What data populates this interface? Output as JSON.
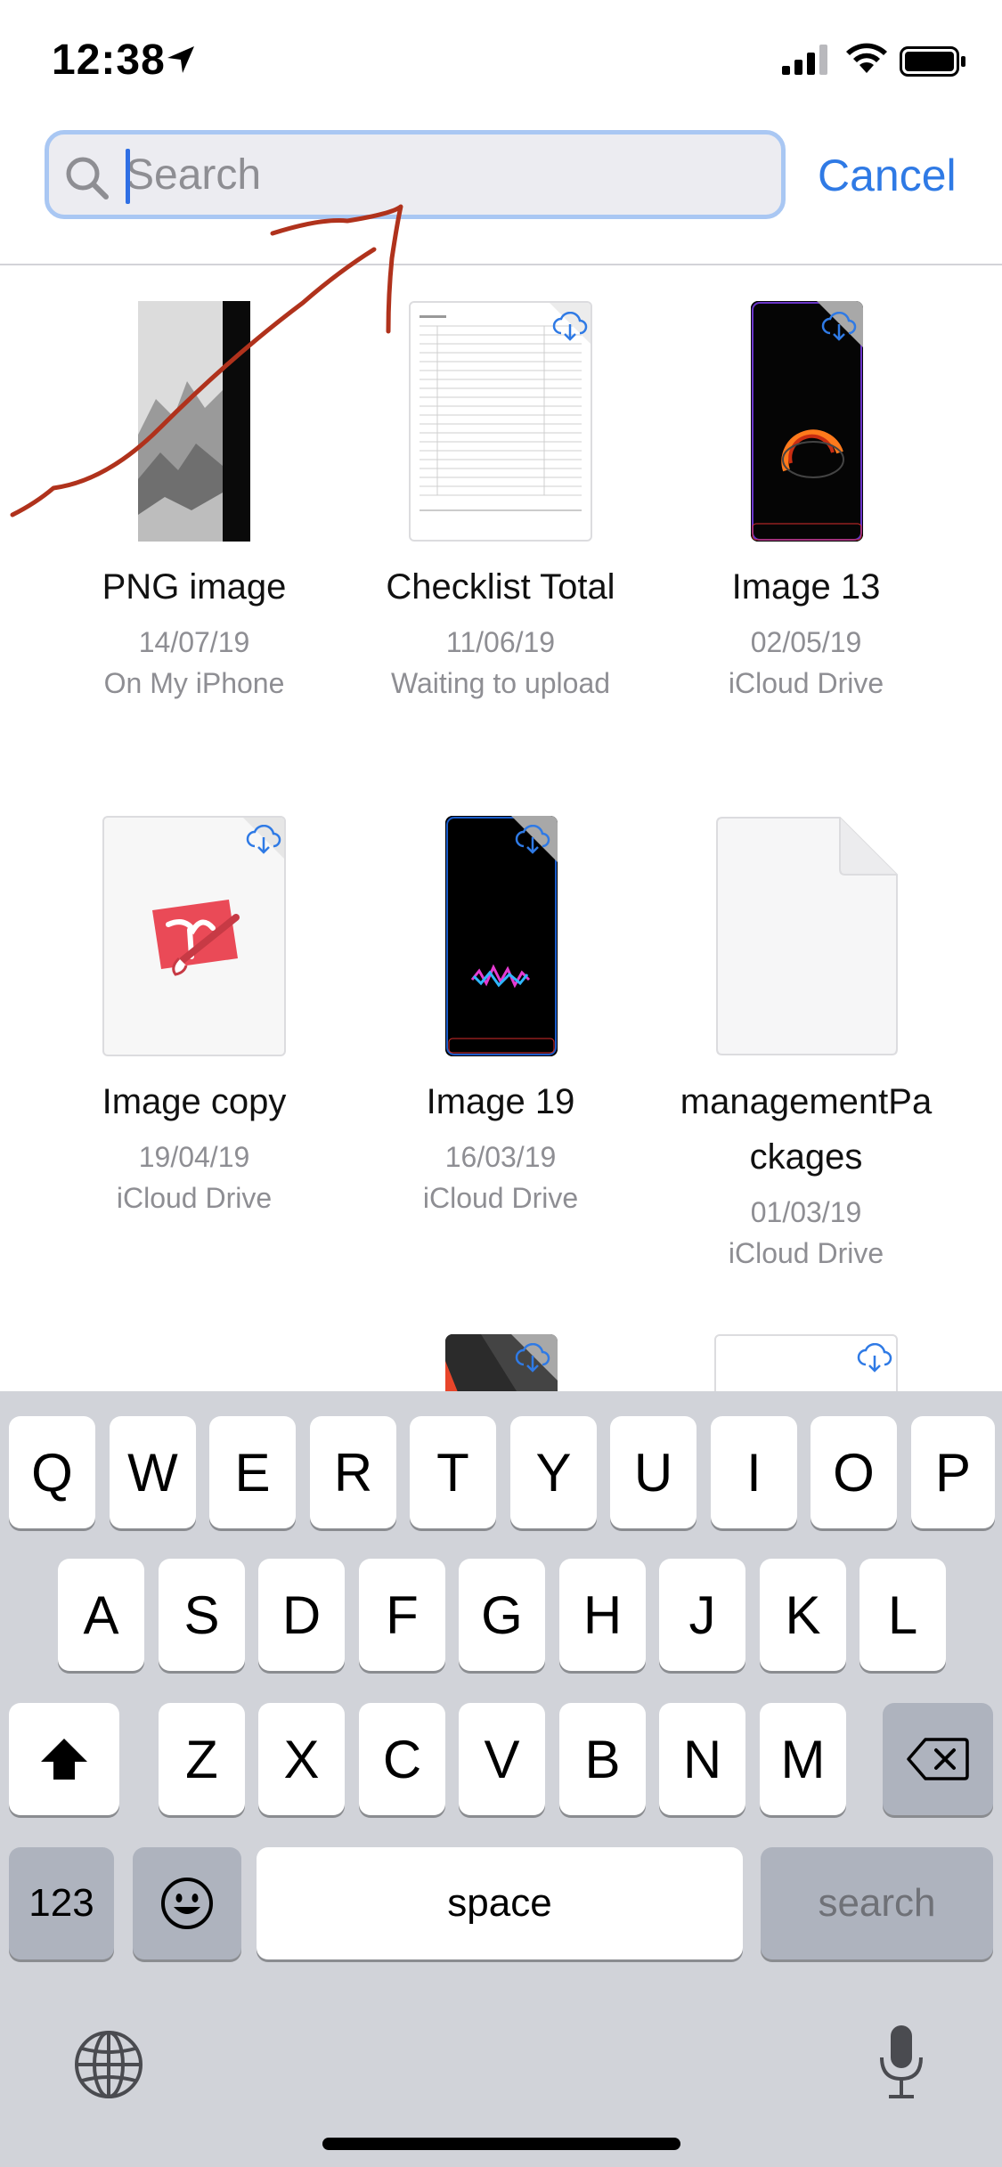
{
  "status_bar": {
    "time": "12:38"
  },
  "search": {
    "placeholder": "Search",
    "value": "",
    "cancel_label": "Cancel"
  },
  "files": [
    {
      "name": "PNG image",
      "date": "14/07/19",
      "location": "On My iPhone"
    },
    {
      "name": "Checklist Total",
      "date": "11/06/19",
      "location": "Waiting to upload"
    },
    {
      "name": "Image 13",
      "date": "02/05/19",
      "location": "iCloud Drive"
    },
    {
      "name": "Image copy",
      "date": "19/04/19",
      "location": "iCloud Drive"
    },
    {
      "name": "Image 19",
      "date": "16/03/19",
      "location": "iCloud Drive"
    },
    {
      "name_line1": "managementPa",
      "name_line2": "ckages",
      "date": "01/03/19",
      "location": "iCloud Drive"
    }
  ],
  "keyboard": {
    "row1": [
      "Q",
      "W",
      "E",
      "R",
      "T",
      "Y",
      "U",
      "I",
      "O",
      "P"
    ],
    "row2": [
      "A",
      "S",
      "D",
      "F",
      "G",
      "H",
      "J",
      "K",
      "L"
    ],
    "row3": [
      "Z",
      "X",
      "C",
      "V",
      "B",
      "N",
      "M"
    ],
    "numbers_label": "123",
    "space_label": "space",
    "search_label": "search"
  },
  "colors": {
    "accent": "#2f7ae5",
    "annotation": "#b0321c"
  }
}
